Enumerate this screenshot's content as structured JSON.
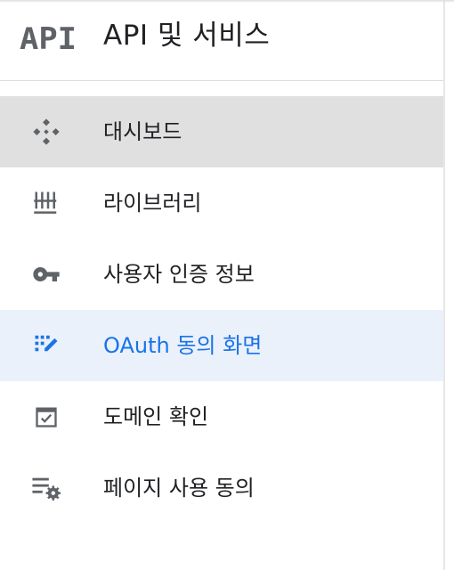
{
  "header": {
    "logo_text": "API",
    "title": "API 및 서비스"
  },
  "nav": {
    "items": [
      {
        "label": "대시보드",
        "icon": "dashboard-icon",
        "state": "hover"
      },
      {
        "label": "라이브러리",
        "icon": "library-icon",
        "state": "normal"
      },
      {
        "label": "사용자 인증 정보",
        "icon": "key-icon",
        "state": "normal"
      },
      {
        "label": "OAuth 동의 화면",
        "icon": "oauth-consent-icon",
        "state": "selected"
      },
      {
        "label": "도메인 확인",
        "icon": "check-box-icon",
        "state": "normal"
      },
      {
        "label": "페이지 사용 동의",
        "icon": "page-settings-icon",
        "state": "normal"
      }
    ]
  },
  "colors": {
    "text": "#202124",
    "icon": "#5f6368",
    "accent": "#1a73e8",
    "hover_bg": "#e0e0e0",
    "selected_bg": "#eaf1fb"
  }
}
